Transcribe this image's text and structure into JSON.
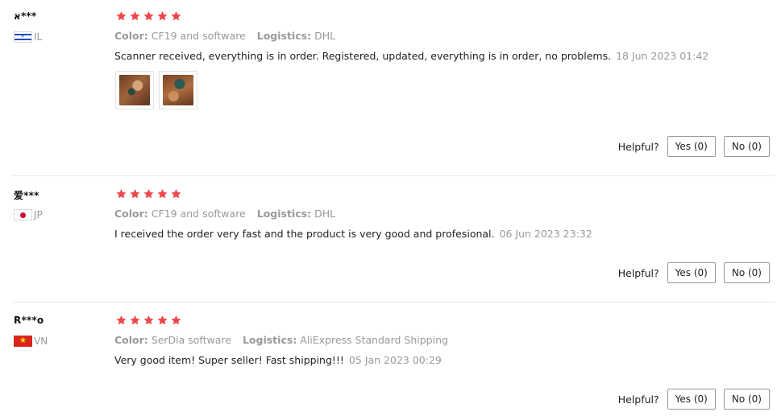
{
  "colors": {
    "star": "#f0474c",
    "muted": "#999999",
    "text": "#222222",
    "divider": "#e8e8e8"
  },
  "helpful_label": "Helpful?",
  "reviews": [
    {
      "user": "א***",
      "country": "IL",
      "flag": "israel-flag-icon",
      "rating": 5,
      "color_label": "Color:",
      "color_value": "CF19 and software",
      "logistics_label": "Logistics:",
      "logistics_value": "DHL",
      "text": "Scanner received, everything is in order. Registered, updated, everything is in order, no problems.",
      "date": "18 Jun 2023 01:42",
      "photos": [
        "review-photo",
        "review-photo"
      ],
      "yes_label": "Yes (0)",
      "no_label": "No (0)"
    },
    {
      "user": "爱***",
      "country": "JP",
      "flag": "japan-flag-icon",
      "rating": 5,
      "color_label": "Color:",
      "color_value": "CF19 and software",
      "logistics_label": "Logistics:",
      "logistics_value": "DHL",
      "text": "I received the order very fast and the product is very good and profesional.",
      "date": "06 Jun 2023 23:32",
      "photos": [],
      "yes_label": "Yes (0)",
      "no_label": "No (0)"
    },
    {
      "user": "R***o",
      "country": "VN",
      "flag": "vietnam-flag-icon",
      "rating": 5,
      "color_label": "Color:",
      "color_value": "SerDia software",
      "logistics_label": "Logistics:",
      "logistics_value": "AliExpress Standard Shipping",
      "text": "Very good item! Super seller! Fast shipping!!!",
      "date": "05 Jan 2023 00:29",
      "photos": [],
      "yes_label": "Yes (0)",
      "no_label": "No (0)"
    }
  ]
}
